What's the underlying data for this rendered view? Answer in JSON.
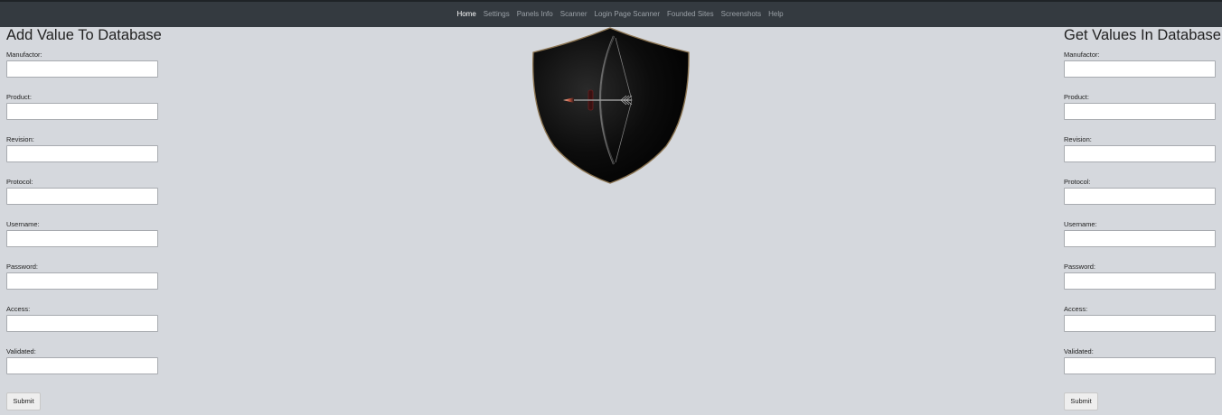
{
  "nav": {
    "items": [
      {
        "label": "Home",
        "active": true
      },
      {
        "label": "Settings",
        "active": false
      },
      {
        "label": "Panels Info",
        "active": false
      },
      {
        "label": "Scanner",
        "active": false
      },
      {
        "label": "Login Page Scanner",
        "active": false
      },
      {
        "label": "Founded Sites",
        "active": false
      },
      {
        "label": "Screenshots",
        "active": false
      },
      {
        "label": "Help",
        "active": false
      }
    ]
  },
  "logo": {
    "icon": "shield-bow-arrow-icon"
  },
  "add_form": {
    "title": "Add Value To Database",
    "fields": [
      {
        "label": "Manufactor:",
        "value": ""
      },
      {
        "label": "Product:",
        "value": ""
      },
      {
        "label": "Revision:",
        "value": ""
      },
      {
        "label": "Protocol:",
        "value": ""
      },
      {
        "label": "Username:",
        "value": ""
      },
      {
        "label": "Password:",
        "value": ""
      },
      {
        "label": "Access:",
        "value": ""
      },
      {
        "label": "Validated:",
        "value": ""
      }
    ],
    "submit_label": "Submit"
  },
  "get_form": {
    "title": "Get Values In Database",
    "fields": [
      {
        "label": "Manufactor:",
        "value": ""
      },
      {
        "label": "Product:",
        "value": ""
      },
      {
        "label": "Revision:",
        "value": ""
      },
      {
        "label": "Protocol:",
        "value": ""
      },
      {
        "label": "Username:",
        "value": ""
      },
      {
        "label": "Password:",
        "value": ""
      },
      {
        "label": "Access:",
        "value": ""
      },
      {
        "label": "Validated:",
        "value": ""
      }
    ],
    "submit_label": "Submit"
  }
}
